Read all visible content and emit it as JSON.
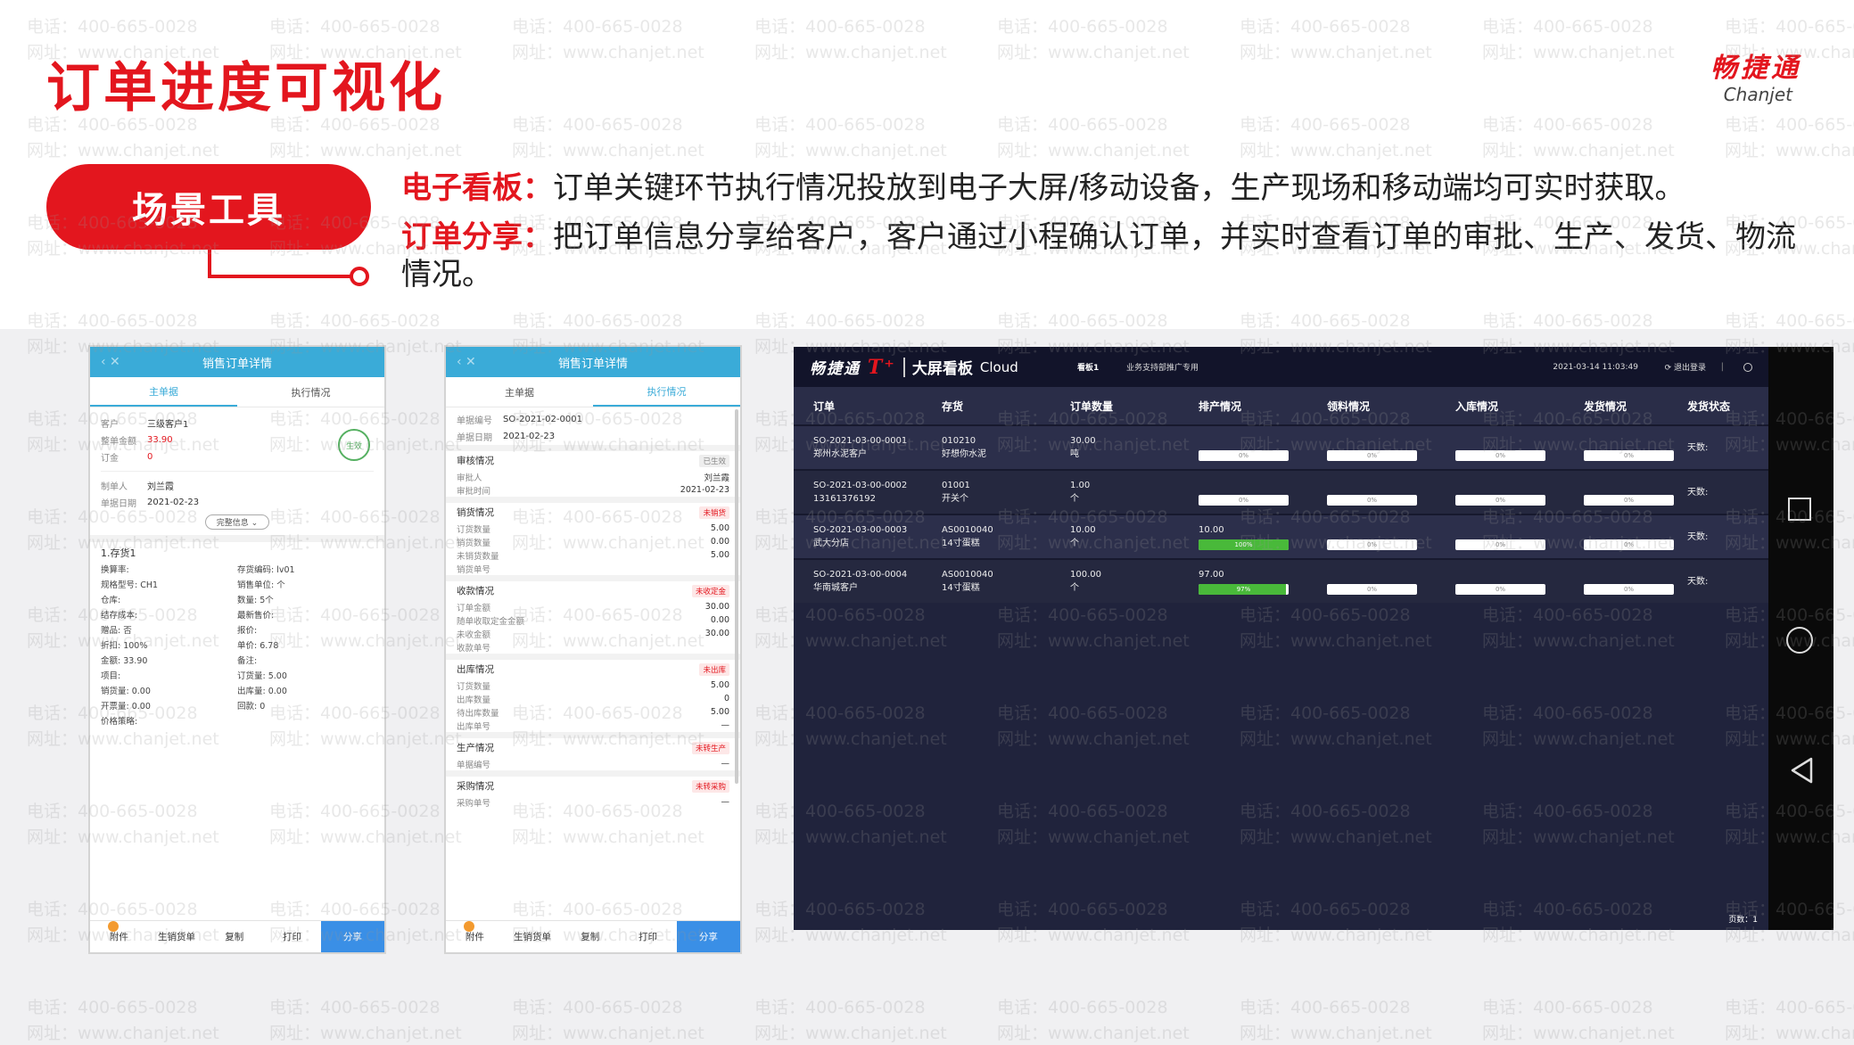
{
  "watermark": {
    "phone": "电话：400-665-0028",
    "site": "网址：www.chanjet.net"
  },
  "header": {
    "title": "订单进度可视化",
    "logo_cn": "畅捷通",
    "logo_en": "Chanjet"
  },
  "scene": {
    "label": "场景工具"
  },
  "descriptions": [
    {
      "label": "电子看板：",
      "text": "订单关键环节执行情况投放到电子大屏/移动设备，生产现场和移动端均可实时获取。"
    },
    {
      "label": "订单分享：",
      "text": "把订单信息分享给客户，客户通过小程确认订单，并实时查看订单的审批、生产、发货、物流情况。"
    }
  ],
  "phone1": {
    "title": "销售订单详情",
    "tabs": [
      "主单据",
      "执行情况"
    ],
    "fields": [
      {
        "k": "客户",
        "v": "三级客户1"
      },
      {
        "k": "整单金额",
        "v": "33.90",
        "red": true
      },
      {
        "k": "订金",
        "v": "0",
        "red": true
      }
    ],
    "fields2": [
      {
        "k": "制单人",
        "v": "刘兰霞"
      },
      {
        "k": "单据日期",
        "v": "2021-02-23"
      }
    ],
    "stamp": "生效",
    "expand": "完整信息 ⌄",
    "item_title": "1.存货1",
    "item_fields": [
      "换算率:",
      "存货编码: lv01",
      "规格型号: CH1",
      "销售单位: 个",
      "仓库:",
      "数量: 5个",
      "结存成本:",
      "最新售价:",
      "赠品: 否",
      "报价:",
      "折扣: 100%",
      "单价: 6.78",
      "金额: 33.90",
      "备注:",
      "项目:",
      "订货量: 5.00",
      "销货量: 0.00",
      "出库量: 0.00",
      "开票量: 0.00",
      "回款: 0",
      "价格策略:",
      ""
    ],
    "bottom": [
      "附件",
      "生销货单",
      "复制",
      "打印",
      "分享"
    ]
  },
  "phone2": {
    "title": "销售订单详情",
    "tabs": [
      "主单据",
      "执行情况"
    ],
    "head": [
      {
        "k": "单据编号",
        "v": "SO-2021-02-0001"
      },
      {
        "k": "单据日期",
        "v": "2021-02-23"
      }
    ],
    "sections": [
      {
        "title": "审核情况",
        "tag": "已生效",
        "ok": true,
        "rows": [
          {
            "k": "审批人",
            "v": "刘兰霞"
          },
          {
            "k": "审批时间",
            "v": "2021-02-23"
          }
        ]
      },
      {
        "title": "销货情况",
        "tag": "未销货",
        "rows": [
          {
            "k": "订货数量",
            "v": "5.00"
          },
          {
            "k": "销货数量",
            "v": "0.00"
          },
          {
            "k": "未销货数量",
            "v": "5.00"
          },
          {
            "k": "销货单号",
            "v": ""
          }
        ]
      },
      {
        "title": "收款情况",
        "tag": "未收定金",
        "rows": [
          {
            "k": "订单金额",
            "v": "30.00"
          },
          {
            "k": "随单收取定金金额",
            "v": "0.00"
          },
          {
            "k": "未收金额",
            "v": "30.00"
          },
          {
            "k": "收款单号",
            "v": ""
          }
        ]
      },
      {
        "title": "出库情况",
        "tag": "未出库",
        "rows": [
          {
            "k": "订货数量",
            "v": "5.00"
          },
          {
            "k": "出库数量",
            "v": "0"
          },
          {
            "k": "待出库数量",
            "v": "5.00"
          },
          {
            "k": "出库单号",
            "v": "—"
          }
        ]
      },
      {
        "title": "生产情况",
        "tag": "未转生产",
        "rows": [
          {
            "k": "单据编号",
            "v": "—"
          }
        ]
      },
      {
        "title": "采购情况",
        "tag": "未转采购",
        "rows": [
          {
            "k": "采购单号",
            "v": "—"
          }
        ]
      }
    ],
    "bottom": [
      "附件",
      "生销货单",
      "复制",
      "打印",
      "分享"
    ]
  },
  "dashboard": {
    "logo": "畅捷通",
    "logo_t": "T⁺",
    "title": "大屏看板",
    "cloud": "Cloud",
    "menu1": "看板1",
    "menu2": "业务支持部推广专用",
    "time": "2021-03-14 11:03:49",
    "logout": "⟳ 退出登录",
    "columns": [
      "订单",
      "存货",
      "订单数量",
      "排产情况",
      "领料情况",
      "入库情况",
      "发货情况",
      "发货状态"
    ],
    "rows": [
      {
        "order": "SO-2021-03-00-0001",
        "customer": "郑州水泥客户",
        "code": "010210",
        "name": "好想你水泥",
        "qty": "30.00",
        "unit": "吨",
        "prod_label": "",
        "progress": [
          0,
          0,
          0,
          0
        ],
        "labels": [
          "0%",
          "0%",
          "0%",
          "0%"
        ],
        "status": "天数:"
      },
      {
        "order": "SO-2021-03-00-0002",
        "customer": "13161376192",
        "code": "01001",
        "name": "开关个",
        "qty": "1.00",
        "unit": "个",
        "prod_label": "",
        "progress": [
          0,
          0,
          0,
          0
        ],
        "labels": [
          "0%",
          "0%",
          "0%",
          "0%"
        ],
        "status": "天数:"
      },
      {
        "order": "SO-2021-03-00-0003",
        "customer": "武大分店",
        "code": "AS0010040",
        "name": "14寸蛋糕",
        "qty": "10.00",
        "unit": "个",
        "prod_label": "10.00",
        "progress": [
          100,
          0,
          0,
          0
        ],
        "labels": [
          "100%",
          "0%",
          "0%",
          "0%"
        ],
        "status": "天数:"
      },
      {
        "order": "SO-2021-03-00-0004",
        "customer": "华南城客户",
        "code": "AS0010040",
        "name": "14寸蛋糕",
        "qty": "100.00",
        "unit": "个",
        "prod_label": "97.00",
        "progress": [
          97,
          0,
          0,
          0
        ],
        "labels": [
          "97%",
          "0%",
          "0%",
          "0%"
        ],
        "status": "天数:"
      }
    ],
    "footer": "页数：1"
  },
  "colors": {
    "accent": "#e3161e",
    "app_blue": "#3aabd8",
    "progress_green": "#49b93a",
    "dash_bg": "#20233c"
  }
}
